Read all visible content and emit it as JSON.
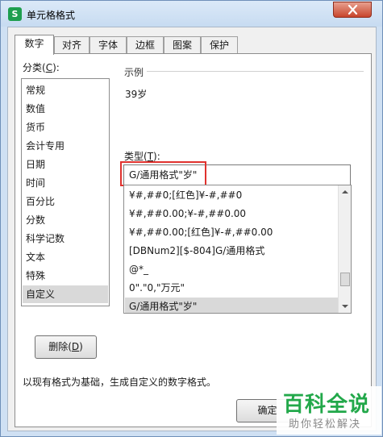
{
  "window": {
    "title": "单元格格式",
    "app_icon_letter": "S",
    "accent_color": "#1e9e4f"
  },
  "tabs": [
    {
      "label": "数字",
      "active": true
    },
    {
      "label": "对齐",
      "active": false
    },
    {
      "label": "字体",
      "active": false
    },
    {
      "label": "边框",
      "active": false
    },
    {
      "label": "图案",
      "active": false
    },
    {
      "label": "保护",
      "active": false
    }
  ],
  "category": {
    "label": "分类(",
    "hotkey": "C",
    "label_end": "):",
    "items": [
      "常规",
      "数值",
      "货币",
      "会计专用",
      "日期",
      "时间",
      "百分比",
      "分数",
      "科学记数",
      "文本",
      "特殊",
      "自定义"
    ],
    "selected_index": 11
  },
  "sample": {
    "legend": "示例",
    "value": "39岁"
  },
  "type_field": {
    "label": "类型(",
    "hotkey": "T",
    "label_end": "):",
    "value": "G/通用格式\"岁\"",
    "highlight_color": "#e0322e"
  },
  "format_list": {
    "items": [
      "¥#,##0;[红色]¥-#,##0",
      "¥#,##0.00;¥-#,##0.00",
      "¥#,##0.00;[红色]¥-#,##0.00",
      "[DBNum2][$-804]G/通用格式",
      "@*_",
      "0\".\"0,\"万元\"",
      "G/通用格式\"岁\""
    ],
    "selected_index": 6
  },
  "delete_button": {
    "label": "删除(",
    "hotkey": "D",
    "label_end": ")"
  },
  "description": "以现有格式为基础，生成自定义的数字格式。",
  "ok_button": {
    "label": "确定"
  },
  "watermark": {
    "main": "百科全说",
    "sub": "助你轻松解决",
    "color": "#22a84a"
  }
}
